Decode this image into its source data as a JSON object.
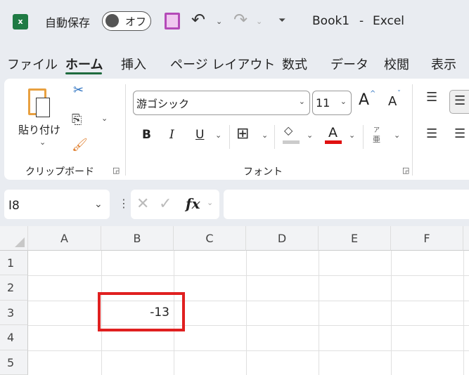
{
  "title_bar": {
    "autosave_label": "自動保存",
    "autosave_state": "オフ",
    "doc_title": "Book1",
    "separator": "-",
    "app_name": "Excel"
  },
  "tabs": [
    "ファイル",
    "ホーム",
    "挿入",
    "ページ レイアウト",
    "数式",
    "データ",
    "校閲",
    "表示"
  ],
  "active_tab": "ホーム",
  "ribbon": {
    "clipboard": {
      "paste_label": "貼り付け",
      "group_label": "クリップボード"
    },
    "font": {
      "font_name": "游ゴシック",
      "font_size": "11",
      "bold": "B",
      "italic": "I",
      "underline": "U",
      "font_color_glyph": "A",
      "grow": "A",
      "shrink": "A",
      "phonetic_top": "ア",
      "phonetic_bottom": "亜",
      "group_label": "フォント",
      "font_color": "#e01010"
    }
  },
  "formula_bar": {
    "name_box": "I8",
    "fx": "fx",
    "value": ""
  },
  "grid": {
    "columns": [
      "A",
      "B",
      "C",
      "D",
      "E",
      "F"
    ],
    "rows": [
      "1",
      "2",
      "3",
      "4",
      "5"
    ],
    "cells": {
      "B3": "-13"
    },
    "highlight_color": "#e02020"
  }
}
